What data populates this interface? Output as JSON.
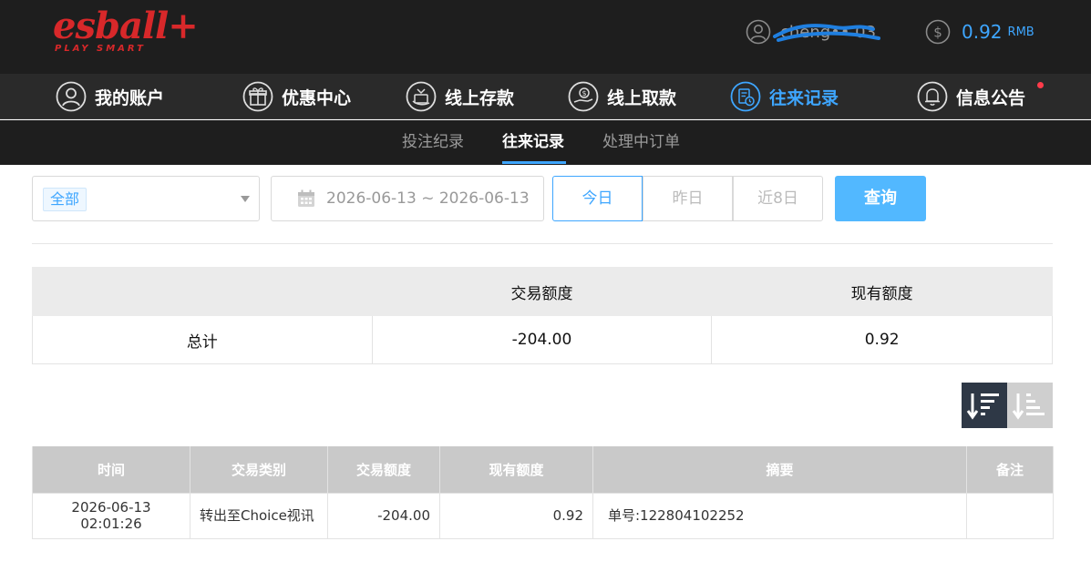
{
  "header": {
    "logo_text": "esball+",
    "logo_tagline": "PLAY SMART",
    "username": "cheng•• 03",
    "balance": "0.92",
    "currency": "RMB",
    "accent_color": "#3ea6ff",
    "brand_color": "#d8282a"
  },
  "nav": {
    "items": [
      {
        "label": "我的账户",
        "icon": "user-circle-icon"
      },
      {
        "label": "优惠中心",
        "icon": "gift-icon"
      },
      {
        "label": "线上存款",
        "icon": "deposit-icon"
      },
      {
        "label": "线上取款",
        "icon": "withdraw-icon"
      },
      {
        "label": "往来记录",
        "icon": "records-icon",
        "active": true
      },
      {
        "label": "信息公告",
        "icon": "bell-icon",
        "has_notification": true
      }
    ]
  },
  "subnav": {
    "tabs": [
      {
        "label": "投注纪录"
      },
      {
        "label": "往来记录",
        "active": true
      },
      {
        "label": "处理中订单"
      }
    ]
  },
  "filters": {
    "type_selected": "全部",
    "date_range": "2026-06-13 ~ 2026-06-13",
    "ranges": [
      "今日",
      "昨日",
      "近8日"
    ],
    "active_range": "今日",
    "query_label": "查询"
  },
  "summary": {
    "headers": [
      "",
      "交易额度",
      "现有额度"
    ],
    "row": {
      "label": "总计",
      "amount": "-204.00",
      "balance": "0.92"
    }
  },
  "sort": {
    "desc_icon": "sort-descending-icon",
    "asc_icon": "sort-ascending-icon",
    "active": "desc"
  },
  "details": {
    "headers": [
      "时间",
      "交易类别",
      "交易额度",
      "现有额度",
      "摘要",
      "备注"
    ],
    "rows": [
      {
        "time": "2026-06-13 02:01:26",
        "category": "转出至Choice视讯",
        "amount": "-204.00",
        "balance": "0.92",
        "summary": "单号:122804102252",
        "note": ""
      }
    ]
  }
}
